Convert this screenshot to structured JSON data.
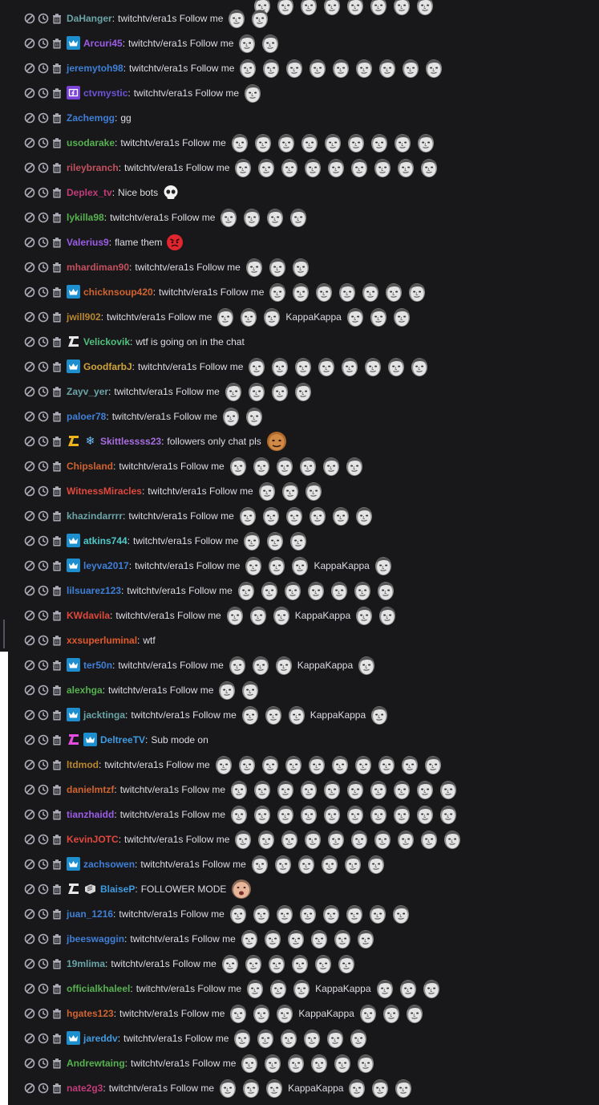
{
  "chat": {
    "separator": ":",
    "lines": [
      {
        "user": "DaHanger",
        "color": "#6ba4a6",
        "badges": [],
        "message": "twitchtv/era1s Follow me",
        "parts": [
          "k2"
        ]
      },
      {
        "user": "Arcuri45",
        "color": "#9b5de5",
        "badges": [
          "crown"
        ],
        "message": "twitchtv/era1s Follow me",
        "parts": [
          "k2"
        ]
      },
      {
        "user": "jeremytoh98",
        "color": "#3f7fd6",
        "badges": [],
        "message": "twitchtv/era1s Follow me",
        "parts": [
          "k9"
        ]
      },
      {
        "user": "ctvmystic",
        "color": "#6d54d6",
        "badges": [
          "prime"
        ],
        "message": "twitchtv/era1s Follow me",
        "parts": [
          "k1"
        ]
      },
      {
        "user": "Zachemgg",
        "color": "#3f7fd6",
        "badges": [],
        "message": "gg",
        "parts": []
      },
      {
        "user": "usodarake",
        "color": "#56b14f",
        "badges": [],
        "message": "twitchtv/era1s Follow me",
        "parts": [
          "k9"
        ]
      },
      {
        "user": "rileybranch",
        "color": "#c2505e",
        "badges": [],
        "message": "twitchtv/era1s Follow me",
        "parts": [
          "k9"
        ]
      },
      {
        "user": "Deplex_tv",
        "color": "#c23c7a",
        "badges": [],
        "message": "Nice bots",
        "parts": [
          "skull"
        ]
      },
      {
        "user": "lykilla98",
        "color": "#56b14f",
        "badges": [],
        "message": "twitchtv/era1s Follow me",
        "parts": [
          "k4"
        ]
      },
      {
        "user": "Valerius9",
        "color": "#9b5de5",
        "badges": [],
        "message": "flame them",
        "parts": [
          "angry"
        ]
      },
      {
        "user": "mhardiman90",
        "color": "#c2505e",
        "badges": [],
        "message": "twitchtv/era1s Follow me",
        "parts": [
          "k3"
        ]
      },
      {
        "user": "chicknsoup420",
        "color": "#d1642e",
        "badges": [
          "crown"
        ],
        "message": "twitchtv/era1s Follow me",
        "parts": [
          "k7"
        ]
      },
      {
        "user": "jwill902",
        "color": "#b8862e",
        "badges": [],
        "message": "twitchtv/era1s Follow me",
        "parts": [
          "k3",
          "KappaKappa",
          "k3"
        ]
      },
      {
        "user": "Velickovik",
        "color": "#4fc07c",
        "badges": [
          "l-white"
        ],
        "message": "wtf is going on in the chat",
        "parts": []
      },
      {
        "user": "GoodfarbJ",
        "color": "#d0a43a",
        "badges": [
          "crown"
        ],
        "message": "twitchtv/era1s Follow me",
        "parts": [
          "k8"
        ]
      },
      {
        "user": "Zayv_yer",
        "color": "#6ba4a6",
        "badges": [],
        "message": "twitchtv/era1s Follow me",
        "parts": [
          "k4"
        ]
      },
      {
        "user": "paloer78",
        "color": "#3f7fd6",
        "badges": [],
        "message": "twitchtv/era1s Follow me",
        "parts": [
          "k2"
        ]
      },
      {
        "user": "Skittlessss23",
        "color": "#a86ee0",
        "badges": [
          "l-gold",
          "snow"
        ],
        "message": "followers only chat pls",
        "parts": [
          "face"
        ]
      },
      {
        "user": "Chipsland",
        "color": "#d1642e",
        "badges": [],
        "message": "twitchtv/era1s Follow me",
        "parts": [
          "k6"
        ]
      },
      {
        "user": "WitnessMiracles",
        "color": "#e0483c",
        "badges": [],
        "message": "twitchtv/era1s Follow me",
        "parts": [
          "k3"
        ]
      },
      {
        "user": "khazindarrrr",
        "color": "#6ba4a6",
        "badges": [],
        "message": "twitchtv/era1s Follow me",
        "parts": [
          "k6"
        ]
      },
      {
        "user": "atkins744",
        "color": "#4fc9c9",
        "badges": [
          "crown"
        ],
        "message": "twitchtv/era1s Follow me",
        "parts": [
          "k3"
        ]
      },
      {
        "user": "leyva2017",
        "color": "#3f7fd6",
        "badges": [
          "crown"
        ],
        "message": "twitchtv/era1s Follow me",
        "parts": [
          "k3",
          "KappaKappa",
          "k1"
        ]
      },
      {
        "user": "lilsuarez123",
        "color": "#3f7fd6",
        "badges": [],
        "message": "twitchtv/era1s Follow me",
        "parts": [
          "k7"
        ]
      },
      {
        "user": "KWdavila",
        "color": "#e0483c",
        "badges": [],
        "message": "twitchtv/era1s Follow me",
        "parts": [
          "k3",
          "KappaKappa",
          "k2"
        ]
      },
      {
        "user": "xxsuperluminal",
        "color": "#e05a2a",
        "badges": [],
        "message": "wtf",
        "parts": []
      },
      {
        "user": "ter50n",
        "color": "#3f7fd6",
        "badges": [
          "crown"
        ],
        "message": "twitchtv/era1s Follow me",
        "parts": [
          "k3",
          "KappaKappa",
          "k1"
        ]
      },
      {
        "user": "alexhga",
        "color": "#56b14f",
        "badges": [],
        "message": "twitchtv/era1s Follow me",
        "parts": [
          "k2"
        ]
      },
      {
        "user": "jacktinga",
        "color": "#6ba4a6",
        "badges": [
          "crown"
        ],
        "message": "twitchtv/era1s Follow me",
        "parts": [
          "k3",
          "KappaKappa",
          "k1"
        ]
      },
      {
        "user": "DeltreeTV",
        "color": "#3f9be0",
        "badges": [
          "l-pink",
          "crown"
        ],
        "message": "Sub mode on",
        "parts": []
      },
      {
        "user": "ltdmod",
        "color": "#b8862e",
        "badges": [],
        "message": "twitchtv/era1s Follow me",
        "parts": [
          "k10"
        ]
      },
      {
        "user": "danielmtzf",
        "color": "#d1642e",
        "badges": [],
        "message": "twitchtv/era1s Follow me",
        "parts": [
          "k10"
        ]
      },
      {
        "user": "tianzhaidd",
        "color": "#9b5de5",
        "badges": [],
        "message": "twitchtv/era1s Follow me",
        "parts": [
          "k10"
        ]
      },
      {
        "user": "KevinJOTC",
        "color": "#e0483c",
        "badges": [],
        "message": "twitchtv/era1s Follow me",
        "parts": [
          "k10"
        ]
      },
      {
        "user": "zachsowen",
        "color": "#3f7fd6",
        "badges": [
          "crown"
        ],
        "message": "twitchtv/era1s Follow me",
        "parts": [
          "k6"
        ]
      },
      {
        "user": "BlaiseP",
        "color": "#3f9be0",
        "badges": [
          "l-white",
          "vip"
        ],
        "message": "FOLLOWER MODE",
        "parts": [
          "baby"
        ]
      },
      {
        "user": "juan_1216",
        "color": "#3f7fd6",
        "badges": [],
        "message": "twitchtv/era1s Follow me",
        "parts": [
          "k8"
        ]
      },
      {
        "user": "jbeeswaggin",
        "color": "#3f7fd6",
        "badges": [],
        "message": "twitchtv/era1s Follow me",
        "parts": [
          "k6"
        ]
      },
      {
        "user": "19mlima",
        "color": "#6ba4a6",
        "badges": [],
        "message": "twitchtv/era1s Follow me",
        "parts": [
          "k6"
        ]
      },
      {
        "user": "officialkhaleel",
        "color": "#56b14f",
        "badges": [],
        "message": "twitchtv/era1s Follow me",
        "parts": [
          "k3",
          "KappaKappa",
          "k3"
        ]
      },
      {
        "user": "hgates123",
        "color": "#d1642e",
        "badges": [],
        "message": "twitchtv/era1s Follow me",
        "parts": [
          "k3",
          "KappaKappa",
          "k3"
        ]
      },
      {
        "user": "jareddv",
        "color": "#3f9be0",
        "badges": [
          "crown"
        ],
        "message": "twitchtv/era1s Follow me",
        "parts": [
          "k6"
        ]
      },
      {
        "user": "Andrewtaing",
        "color": "#56b14f",
        "badges": [],
        "message": "twitchtv/era1s Follow me",
        "parts": [
          "k6"
        ]
      },
      {
        "user": "nate2g3",
        "color": "#c23c7a",
        "badges": [],
        "message": "twitchtv/era1s Follow me",
        "parts": [
          "k3",
          "KappaKappa",
          "k3"
        ]
      }
    ]
  },
  "icons": {
    "ban": "ban-icon",
    "timeout": "timeout-icon",
    "delete": "delete-icon",
    "emote": "kappa-emote-icon"
  }
}
